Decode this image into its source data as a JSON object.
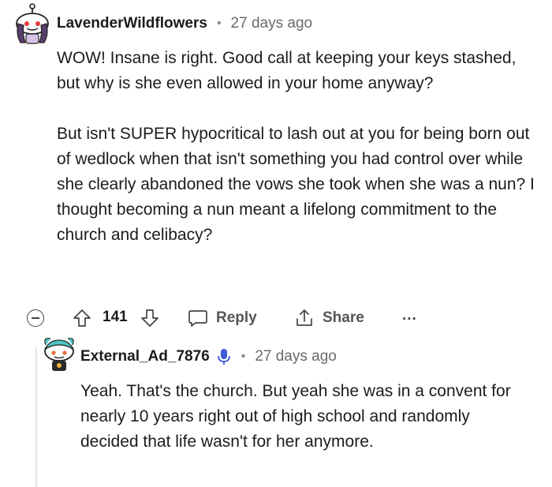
{
  "comments": [
    {
      "username": "LavenderWildflowers",
      "separator": "•",
      "age": "27 days ago",
      "paragraphs": [
        "WOW! Insane is right. Good call at keeping your keys stashed, but why is she even allowed in your home anyway?",
        "But isn't SUPER hypocritical to lash out at you for being born out of wedlock when that isn't something you had control over while she clearly abandoned the vows she took when she was a nun? I thought becoming a nun meant a lifelong commitment to the church and celibacy?"
      ],
      "actions": {
        "vote_count": "141",
        "reply_label": "Reply",
        "share_label": "Share",
        "more_label": "..."
      }
    },
    {
      "username": "External_Ad_7876",
      "separator": "•",
      "age": "27 days ago",
      "paragraphs": [
        "Yeah. That's the church. But yeah she was in a convent for nearly 10 years right out of high school and randomly decided that life wasn't for her anymore."
      ]
    }
  ],
  "icons": {
    "collapse": "collapse-thread-icon",
    "upvote": "upvote-arrow-icon",
    "downvote": "downvote-arrow-icon",
    "reply": "speech-bubble-icon",
    "share": "share-arrow-icon",
    "more": "more-dots-icon",
    "badge": "microphone-badge-icon"
  },
  "colors": {
    "text": "#1c1c1c",
    "meta": "#6a6a6a",
    "action": "#555555",
    "badge": "#3b5bdb"
  }
}
